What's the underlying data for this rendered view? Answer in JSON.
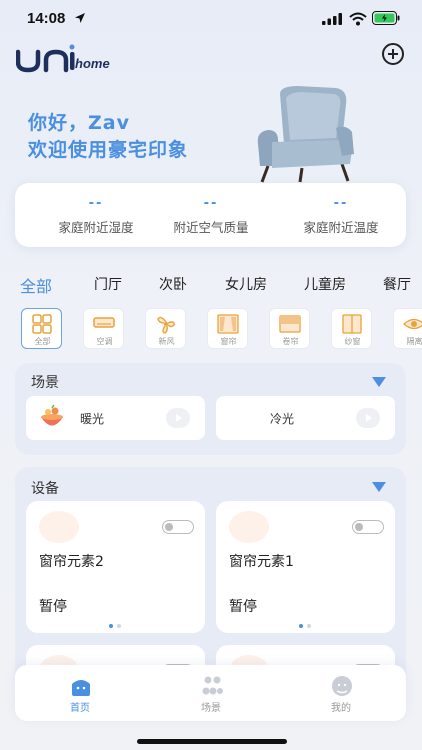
{
  "status_bar": {
    "time": "14:08"
  },
  "header": {
    "logo_text": "home"
  },
  "greeting": {
    "line1": "你好，Zav",
    "line2": "欢迎使用豪宅印象"
  },
  "stats": [
    {
      "value": "--",
      "label": "家庭附近湿度"
    },
    {
      "value": "--",
      "label": "附近空气质量"
    },
    {
      "value": "--",
      "label": "家庭附近温度"
    }
  ],
  "room_tabs": [
    "全部",
    "门厅",
    "次卧",
    "女儿房",
    "儿童房",
    "餐厅"
  ],
  "device_types": [
    "全部",
    "空调",
    "新风",
    "窗帘",
    "卷帘",
    "纱窗",
    "隔离"
  ],
  "scenes": {
    "title": "场景",
    "items": [
      {
        "label": "暖光"
      },
      {
        "label": "冷光"
      }
    ]
  },
  "devices": {
    "title": "设备",
    "items": [
      {
        "name": "窗帘元素2",
        "status": "暂停"
      },
      {
        "name": "窗帘元素1",
        "status": "暂停"
      }
    ]
  },
  "bottom_nav": [
    {
      "label": "首页",
      "icon": "home-icon"
    },
    {
      "label": "场景",
      "icon": "scene-icon"
    },
    {
      "label": "我的",
      "icon": "profile-icon"
    }
  ],
  "colors": {
    "accent": "#4a8fe0",
    "background": "#eef1f7"
  }
}
